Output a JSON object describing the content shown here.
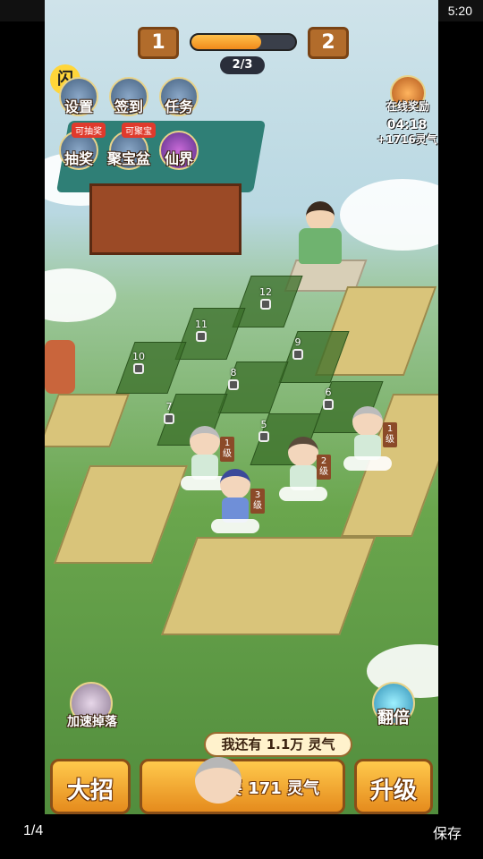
{
  "status_bar": {
    "time": "5:20"
  },
  "progress": {
    "current_level": "1",
    "next_level": "2",
    "label": "2/3",
    "fill_fraction": 0.67
  },
  "flash_icon": "闪",
  "menu": {
    "settings": "设置",
    "checkin": "签到",
    "tasks": "任务",
    "lottery": "抽奖",
    "lottery_badge": "可抽奖",
    "treasure": "聚宝盆",
    "treasure_badge": "可聚宝",
    "fairy_realm": "仙界"
  },
  "online_reward": {
    "label": "在线奖励",
    "time": "04:18",
    "gain": "+1716灵气"
  },
  "slots": [
    "12",
    "11",
    "10",
    "9",
    "8",
    "7",
    "6",
    "5"
  ],
  "heroes": [
    {
      "level_num": "1",
      "level_unit": "级"
    },
    {
      "level_num": "2",
      "level_unit": "级"
    },
    {
      "level_num": "1",
      "level_unit": "级"
    },
    {
      "level_num": "3",
      "level_unit": "级"
    }
  ],
  "side_buttons": {
    "speed_drop": "加速掉落",
    "double": "翻倍"
  },
  "qi_banner": "我还有 1.1万 灵气",
  "bottom": {
    "ultimate": "大招",
    "summon": "需要 171 灵气",
    "upgrade": "升级"
  },
  "footer": {
    "page": "1/4",
    "save": "保存"
  }
}
